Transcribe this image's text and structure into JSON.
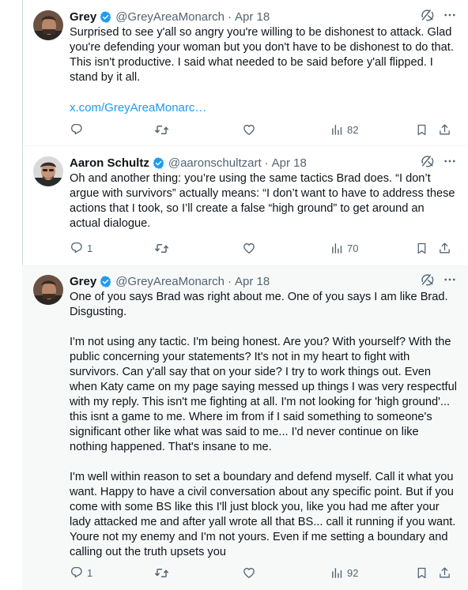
{
  "colors": {
    "accent": "#1d9bf0",
    "muted": "#536471",
    "text": "#0f1419",
    "highlight_bg": "#f7f9f9"
  },
  "tweets": [
    {
      "name": "Grey",
      "handle": "@GreyAreaMonarch",
      "separator": "·",
      "date": "Apr 18",
      "text": "Surprised to see y'all so angry you're willing to be dishonest to attack. Glad you're defending your woman but you don't have to be dishonest to do that. This isn't productive. I said what needed to be said before y'all flipped. I stand by it all.",
      "link": "x.com/GreyAreaMonarc…",
      "replies": "",
      "reposts": "",
      "likes": "",
      "views": "82"
    },
    {
      "name": "Aaron Schultz",
      "handle": "@aaronschultzart",
      "separator": "·",
      "date": "Apr 18",
      "text": "Oh and another thing: you’re using the same tactics Brad does. “I don’t argue with survivors” actually means: “I don’t want to have to address these actions that I took, so I’ll create a false “high ground” to get around an actual dialogue.",
      "replies": "1",
      "reposts": "",
      "likes": "",
      "views": "70"
    },
    {
      "name": "Grey",
      "handle": "@GreyAreaMonarch",
      "separator": "·",
      "date": "Apr 18",
      "text": "One of you says Brad was right about me. One of you says I am like Brad. Disgusting.\n\nI'm not using any tactic. I'm being honest. Are you? With yourself? With the public concerning your statements? It's not in my heart to fight with survivors. Can y'all say that on your side? I try to work things out. Even when Katy came on my page saying messed up things I was very respectful with my reply. This isn't me fighting at all. I'm not looking for 'high ground'... this isnt a game to me. Where im from if I said something to someone's significant other like what was said to me... I'd never continue on like nothing happened. That's insane to me.\n\nI'm well within reason to set a boundary and defend myself. Call it what you want. Happy to have a civil conversation about any specific point. But if you come with some BS like this I'll just block you, like you had me after your lady attacked me and after yall wrote all that BS... call it running if you want. Youre not my enemy and I'm not yours. Even if me setting a boundary and calling out the truth upsets you",
      "replies": "1",
      "reposts": "",
      "likes": "",
      "views": "92"
    }
  ]
}
